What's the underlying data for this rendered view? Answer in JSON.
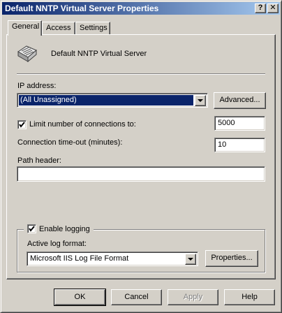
{
  "window": {
    "title": "Default NNTP Virtual Server Properties",
    "help_button": "?",
    "close_button": "✕"
  },
  "tabs": [
    {
      "label": "General",
      "active": true
    },
    {
      "label": "Access",
      "active": false
    },
    {
      "label": "Settings",
      "active": false
    }
  ],
  "general": {
    "server_name": "Default NNTP Virtual Server",
    "ip_address_label": "IP address:",
    "ip_address_value": "(All Unassigned)",
    "advanced_button": "Advanced...",
    "limit_connections_label": "Limit number of connections to:",
    "limit_connections_checked": true,
    "limit_connections_value": "5000",
    "timeout_label": "Connection time-out (minutes):",
    "timeout_value": "10",
    "path_header_label": "Path header:",
    "path_header_value": "",
    "enable_logging_label": "Enable logging",
    "enable_logging_checked": true,
    "log_format_label": "Active log format:",
    "log_format_value": "Microsoft IIS Log File Format",
    "properties_button": "Properties..."
  },
  "footer": {
    "ok": "OK",
    "cancel": "Cancel",
    "apply": "Apply",
    "help": "Help"
  },
  "colors": {
    "title_gradient_start": "#0a246a",
    "title_gradient_end": "#a6caf0",
    "face": "#d4d0c8",
    "selection": "#0a246a"
  }
}
